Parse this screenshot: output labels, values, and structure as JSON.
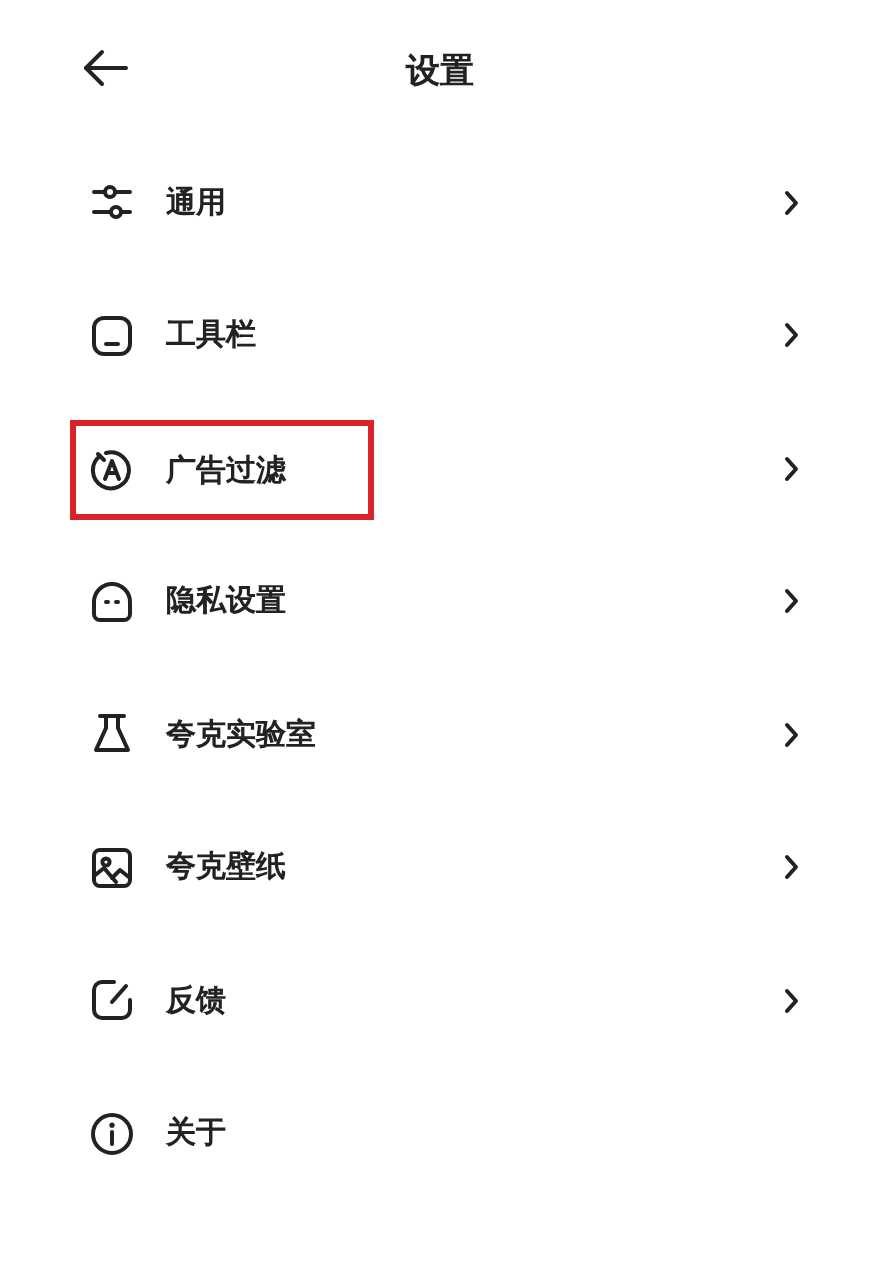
{
  "header": {
    "title": "设置"
  },
  "items": [
    {
      "kind": "sliders",
      "label": "通用",
      "arrow": true,
      "highlighted": false
    },
    {
      "kind": "toolbar",
      "label": "工具栏",
      "arrow": true,
      "highlighted": false
    },
    {
      "kind": "adblock",
      "label": "广告过滤",
      "arrow": true,
      "highlighted": true
    },
    {
      "kind": "privacy",
      "label": "隐私设置",
      "arrow": true,
      "highlighted": false
    },
    {
      "kind": "flask",
      "label": "夸克实验室",
      "arrow": true,
      "highlighted": false
    },
    {
      "kind": "image",
      "label": "夸克壁纸",
      "arrow": true,
      "highlighted": false
    },
    {
      "kind": "feedback",
      "label": "反馈",
      "arrow": true,
      "highlighted": false
    },
    {
      "kind": "info",
      "label": "关于",
      "arrow": false,
      "highlighted": false
    }
  ]
}
